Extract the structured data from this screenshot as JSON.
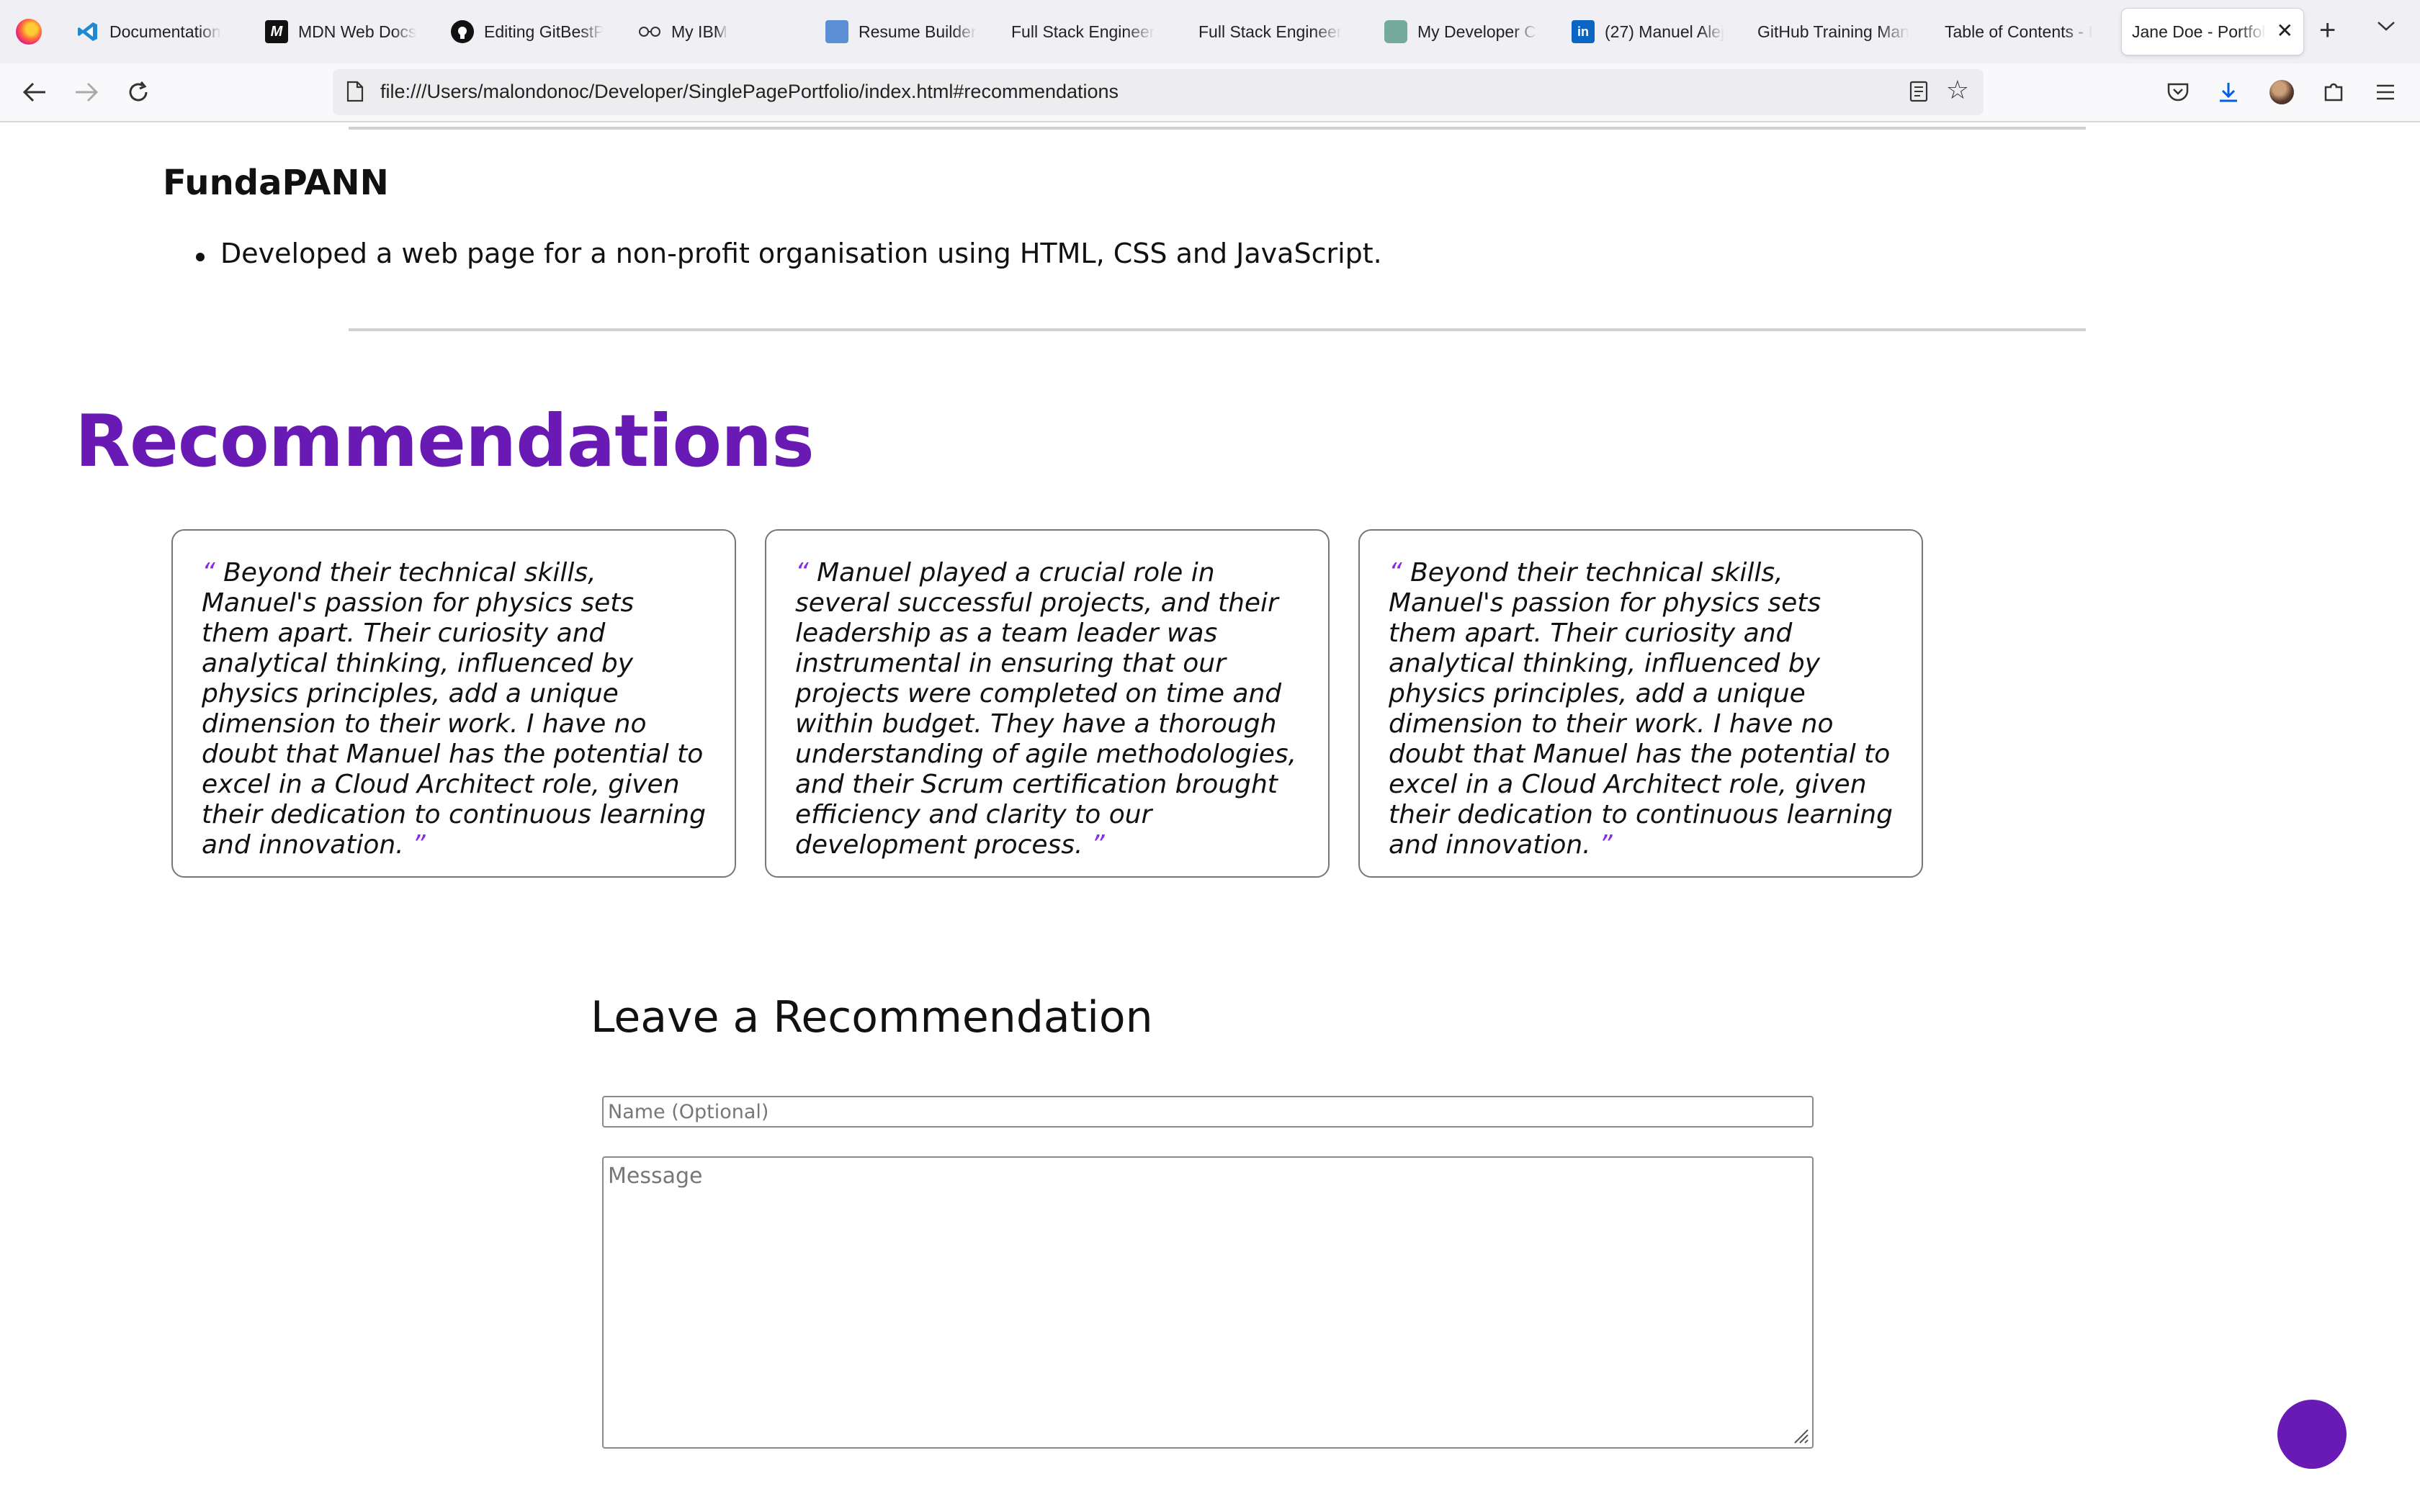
{
  "browser": {
    "tabs": [
      {
        "label": "Documentation",
        "icon": "vscode-icon"
      },
      {
        "label": "MDN Web Docs",
        "icon": "mdn-icon"
      },
      {
        "label": "Editing GitBestPr",
        "icon": "github-icon"
      },
      {
        "label": "My IBM",
        "icon": "ibm-icon"
      },
      {
        "label": "Resume Builder",
        "icon": "resume-icon"
      },
      {
        "label": "Full Stack Engineer",
        "icon": ""
      },
      {
        "label": "Full Stack Engineer",
        "icon": ""
      },
      {
        "label": "My Developer CV",
        "icon": "chatgpt-icon"
      },
      {
        "label": "(27) Manuel Alej",
        "icon": "linkedin-icon"
      },
      {
        "label": "GitHub Training Man",
        "icon": ""
      },
      {
        "label": "Table of Contents - I",
        "icon": ""
      },
      {
        "label": "Jane Doe - Portfolio",
        "icon": "",
        "active": true
      }
    ],
    "url": "file:///Users/malondonoc/Developer/SinglePagePortfolio/index.html#recommendations",
    "colors": {
      "tabbar": "#f0f0f4",
      "navbar": "#f9f9fb",
      "urlbar": "#ededf0"
    }
  },
  "project": {
    "title": "FundaPANN",
    "bullets": [
      "Developed a web page for a non-profit organisation using HTML, CSS and JavaScript."
    ]
  },
  "recommendations": {
    "heading": "Recommendations",
    "open_quote": "“",
    "close_quote": "”",
    "items": [
      "Beyond their technical skills, Manuel's passion for physics sets them apart. Their curiosity and analytical thinking, influenced by physics principles, add a unique dimension to their work. I have no doubt that Manuel has the potential to excel in a Cloud Architect role, given their dedication to continuous learning and innovation.",
      "Manuel played a crucial role in several successful projects, and their leadership as a team leader was instrumental in ensuring that our projects were completed on time and within budget. They have a thorough understanding of agile methodologies, and their Scrum certification brought efficiency and clarity to our development process.",
      "Beyond their technical skills, Manuel's passion for physics sets them apart. Their curiosity and analytical thinking, influenced by physics principles, add a unique dimension to their work. I have no doubt that Manuel has the potential to excel in a Cloud Architect role, given their dedication to continuous learning and innovation."
    ]
  },
  "form": {
    "title": "Leave a Recommendation",
    "name_placeholder": "Name (Optional)",
    "message_placeholder": "Message"
  },
  "colors": {
    "accent": "#6a1ab4",
    "quote": "#8a2be2"
  }
}
